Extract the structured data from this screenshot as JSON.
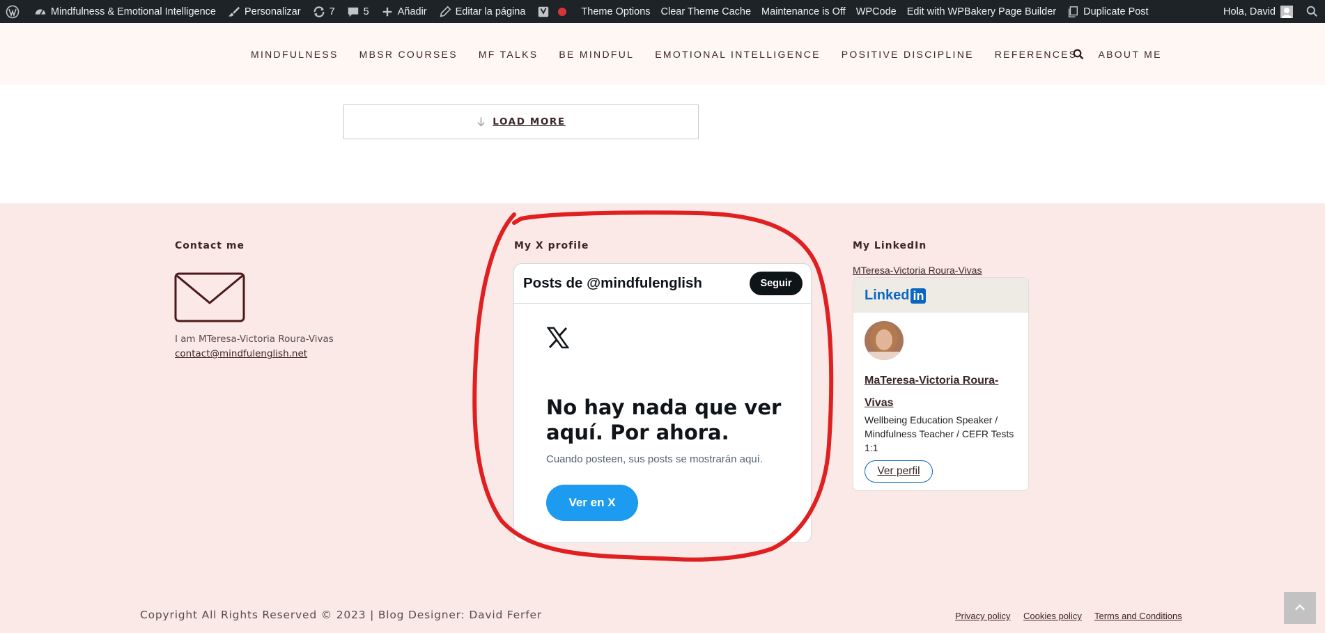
{
  "adminbar": {
    "site_name": "Mindfulness & Emotional Intelligence",
    "customize": "Personalizar",
    "updates_count": "7",
    "comments_count": "5",
    "add_new": "Añadir",
    "edit_page": "Editar la página",
    "theme_options": "Theme Options",
    "clear_cache": "Clear Theme Cache",
    "maintenance": "Maintenance is Off",
    "wpcode": "WPCode",
    "wpbakery": "Edit with WPBakery Page Builder",
    "duplicate": "Duplicate Post",
    "greeting": "Hola, David",
    "status_dot_color": "#d63638"
  },
  "nav": {
    "items": [
      "MINDFULNESS",
      "MBSR COURSES",
      "MF TALKS",
      "BE MINDFUL",
      "EMOTIONAL INTELLIGENCE",
      "POSITIVE DISCIPLINE",
      "REFERENCES",
      "ABOUT ME"
    ]
  },
  "load_more": {
    "label": "LOAD MORE"
  },
  "footer": {
    "contact": {
      "title": "Contact me",
      "text": "I am MTeresa-Victoria Roura-Vivas",
      "email": "contact@mindfulenglish.net"
    },
    "x_profile": {
      "title": "My X profile",
      "widget_title": "Posts de @mindfulenglish",
      "follow_label": "Seguir",
      "empty_title": "No hay nada que ver aquí. Por ahora.",
      "empty_sub": "Cuando posteen, sus posts se mostrarán aquí.",
      "view_label": "Ver en X",
      "accent_color": "#1d9bf0"
    },
    "linkedin": {
      "title": "My LinkedIn",
      "name_link": "MTeresa-Victoria Roura-Vivas",
      "logo_text": "Linked",
      "logo_in": "in",
      "person_name": "MaTeresa-Victoria Roura-Vivas",
      "description": "Wellbeing Education Speaker / Mindfulness Teacher / CEFR Tests 1:1",
      "view_profile": "Ver perfil",
      "brand_color": "#0a66c2"
    }
  },
  "bottom": {
    "copyright": "Copyright All Rights Reserved © 2023 | Blog Designer: David Ferfer",
    "privacy": "Privacy policy",
    "cookies": "Cookies policy",
    "terms": "Terms and Conditions"
  },
  "annotation": {
    "color": "#e02020"
  }
}
